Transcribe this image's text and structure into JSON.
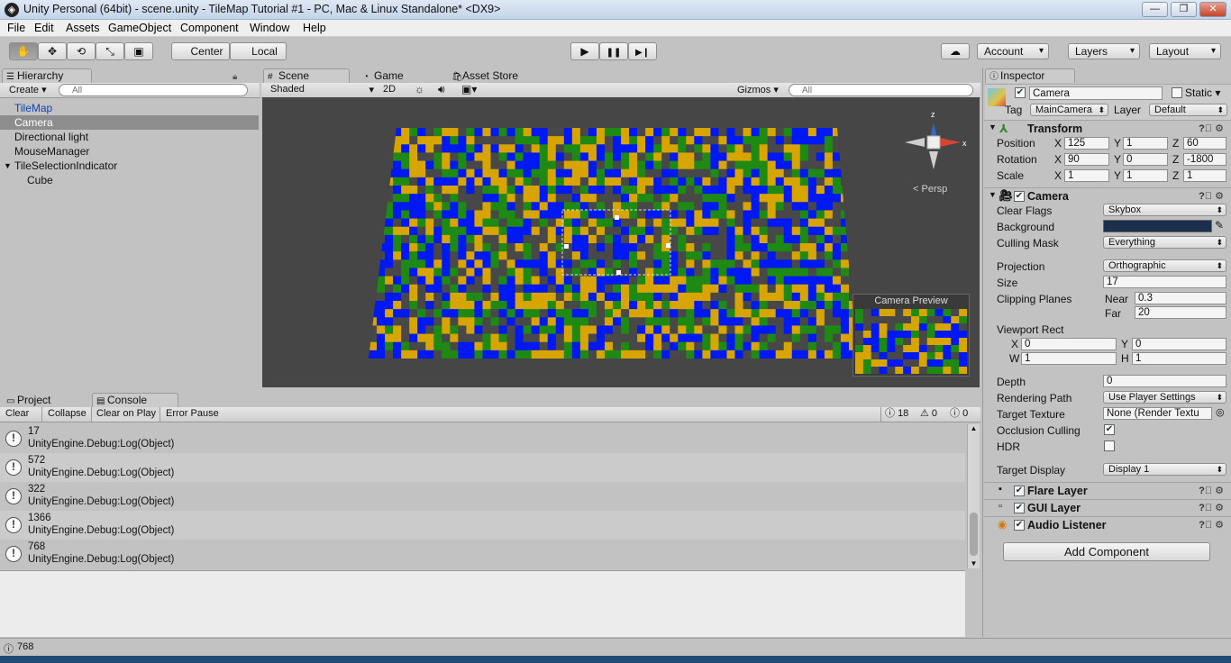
{
  "window": {
    "title": "Unity Personal (64bit) - scene.unity - TileMap Tutorial #1 - PC, Mac & Linux Standalone* <DX9>",
    "min": "—",
    "max": "❐",
    "close": "✕"
  },
  "menu": [
    "File",
    "Edit",
    "Assets",
    "GameObject",
    "Component",
    "Window",
    "Help"
  ],
  "toolbar": {
    "pivot": "Center",
    "space": "Local",
    "account": "Account",
    "layers": "Layers",
    "layout": "Layout",
    "play_icon": "▶",
    "pause_icon": "❚❚",
    "step_icon": "▶❙",
    "cloud_icon": "☁",
    "hand_icon": "✋",
    "move_icon": "✥",
    "rotate_icon": "⟲",
    "scale_icon": "⤡",
    "rect_icon": "▣"
  },
  "hierarchy": {
    "tab": "Hierarchy",
    "create": "Create",
    "search_placeholder": "All",
    "items": [
      "TileMap",
      "Camera",
      "Directional light",
      "MouseManager",
      "TileSelectionIndicator",
      "Cube"
    ],
    "expand_icon": "▼"
  },
  "scene": {
    "tabs": [
      "Scene",
      "Game",
      "Asset Store"
    ],
    "shading": "Shaded",
    "mode2d": "2D",
    "gizmos": "Gizmos",
    "search_placeholder": "All",
    "persp": "Persp",
    "gizmo_x": "x",
    "gizmo_z": "z",
    "camera_preview": "Camera Preview",
    "tile_colors": [
      "#0018f2",
      "#d8a400",
      "#1e8a14",
      "#484848"
    ]
  },
  "console": {
    "tabs": [
      "Project",
      "Console"
    ],
    "buttons": [
      "Clear",
      "Collapse",
      "Clear on Play",
      "Error Pause"
    ],
    "counts": {
      "info": "18",
      "warn": "0",
      "error": "0"
    },
    "entries": [
      {
        "value": "17",
        "src": "UnityEngine.Debug:Log(Object)"
      },
      {
        "value": "572",
        "src": "UnityEngine.Debug:Log(Object)"
      },
      {
        "value": "322",
        "src": "UnityEngine.Debug:Log(Object)"
      },
      {
        "value": "1366",
        "src": "UnityEngine.Debug:Log(Object)"
      },
      {
        "value": "768",
        "src": "UnityEngine.Debug:Log(Object)"
      }
    ]
  },
  "inspector": {
    "tab": "Inspector",
    "name": "Camera",
    "static": "Static",
    "tag_label": "Tag",
    "tag": "MainCamera",
    "layer_label": "Layer",
    "layer": "Default",
    "transform": {
      "title": "Transform",
      "position": {
        "label": "Position",
        "x": "125",
        "y": "1",
        "z": "60"
      },
      "rotation": {
        "label": "Rotation",
        "x": "90",
        "y": "0",
        "z": "-1800"
      },
      "scale": {
        "label": "Scale",
        "x": "1",
        "y": "1",
        "z": "1"
      }
    },
    "camera": {
      "title": "Camera",
      "clear_flags_label": "Clear Flags",
      "clear_flags": "Skybox",
      "background_label": "Background",
      "background_color": "#1c2f4d",
      "culling_label": "Culling Mask",
      "culling": "Everything",
      "projection_label": "Projection",
      "projection": "Orthographic",
      "size_label": "Size",
      "size": "17",
      "clipping_label": "Clipping Planes",
      "near_label": "Near",
      "near": "0.3",
      "far_label": "Far",
      "far": "20",
      "viewport_label": "Viewport Rect",
      "vx": "0",
      "vy": "0",
      "vw": "1",
      "vh": "1",
      "depth_label": "Depth",
      "depth": "0",
      "render_path_label": "Rendering Path",
      "render_path": "Use Player Settings",
      "target_texture_label": "Target Texture",
      "target_texture": "None (Render Textu",
      "occlusion_label": "Occlusion Culling",
      "hdr_label": "HDR",
      "target_display_label": "Target Display",
      "target_display": "Display 1"
    },
    "flare": "Flare Layer",
    "gui": "GUI Layer",
    "audio": "Audio Listener",
    "add_component": "Add Component"
  },
  "status": {
    "text": "768"
  }
}
